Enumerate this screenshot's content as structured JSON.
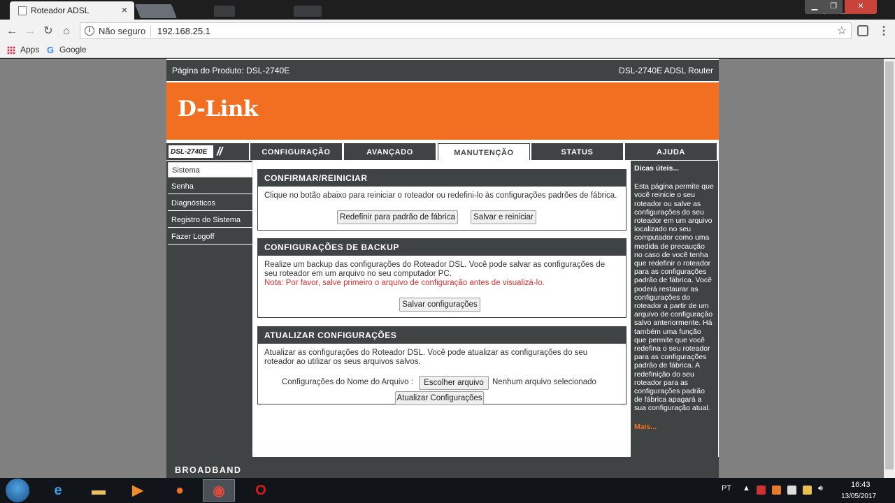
{
  "browser": {
    "tab_title": "Roteador ADSL",
    "tab_close": "×",
    "security_label": "Não seguro",
    "url": "192.168.25.1",
    "bookmarks": [
      {
        "label": "Apps"
      },
      {
        "label": "Google"
      }
    ]
  },
  "router": {
    "product_page": "Página do Produto: DSL-2740E",
    "product_name": "DSL-2740E ADSL Router",
    "brand": "D-Link",
    "model_tag": "DSL-2740E",
    "tabs": [
      {
        "label": "CONFIGURAÇÃO"
      },
      {
        "label": "AVANÇADO"
      },
      {
        "label": "MANUTENÇÃO"
      },
      {
        "label": "STATUS"
      },
      {
        "label": "AJUDA"
      }
    ],
    "sidebar": [
      {
        "label": "Sistema"
      },
      {
        "label": "Senha"
      },
      {
        "label": "Diagnósticos"
      },
      {
        "label": "Registro do Sistema"
      },
      {
        "label": "Fazer Logoff"
      }
    ],
    "reboot": {
      "title": "CONFIRMAR/REINICIAR",
      "text": "Clique no botão abaixo para reiniciar o roteador ou redefini-lo às configurações padrões de fábrica.",
      "factory_button": "Redefinir para padrão de fábrica",
      "save_reboot_button": "Salvar e reiniciar"
    },
    "backup": {
      "title": "CONFIGURAÇÕES DE BACKUP",
      "text": "Realize um backup das configurações do Roteador DSL. Você pode salvar as configurações de seu roteador em um arquivo no seu computador PC.",
      "note": "Nota: Por favor, salve primeiro o arquivo de configuração antes de visualizá-lo.",
      "save_button": "Salvar configurações"
    },
    "update": {
      "title": "ATUALIZAR CONFIGURAÇÕES",
      "text": "Atualizar as configurações do Roteador DSL. Você pode atualizar as configurações do seu roteador ao utilizar os seus arquivos salvos.",
      "file_label": "Configurações do Nome do Arquivo :",
      "choose_button": "Escolher arquivo",
      "no_file": "Nenhum arquivo selecionado",
      "update_button": "Atualizar Configurações"
    },
    "hints": {
      "title": "Dicas úteis...",
      "text": "Esta página permite que você reinicie o seu roteador ou salve as configurações do seu roteador em um arquivo localizado no seu computador como uma medida de precaução no caso de você tenha que redefinir o roteador para as configurações padrão de fábrica. Você poderá restaurar as configurações do roteador a partir de um arquivo de configuração salvo anteriormente. Há também uma função que permite que você redefina o seu roteador para as configurações padrão de fábrica. A redefinição do seu roteador para as configurações padrão de fábrica apagará a sua configuração atual.",
      "more": "Mais..."
    },
    "footer": "BROADBAND"
  },
  "taskbar": {
    "language": "PT",
    "time": "16:43",
    "date": "13/05/2017"
  },
  "colors": {
    "orange": "#f26f21",
    "dark_gray": "#404343",
    "note_red": "#e03030"
  }
}
